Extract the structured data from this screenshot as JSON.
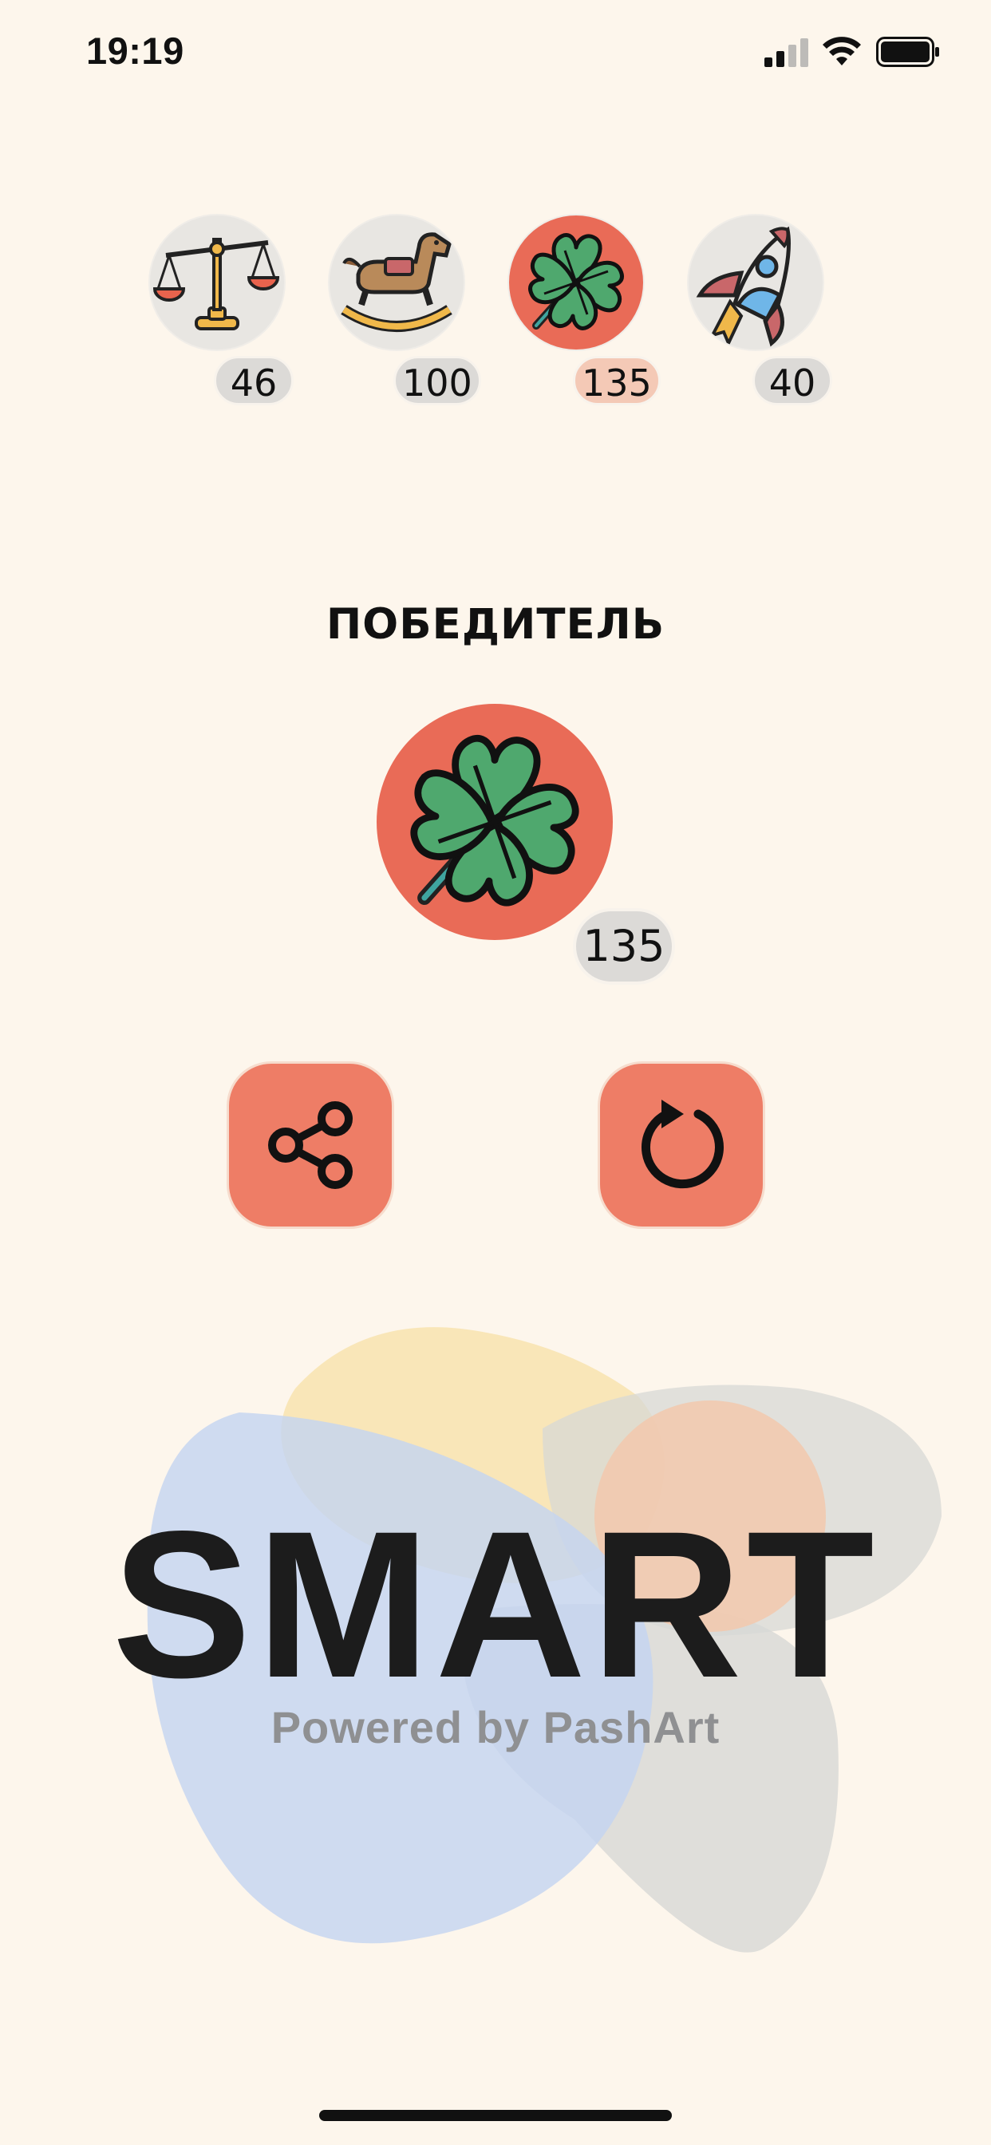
{
  "status_bar": {
    "time": "19:19"
  },
  "players": [
    {
      "icon": "scales-icon",
      "score": "46",
      "active": false
    },
    {
      "icon": "rocking-horse-icon",
      "score": "100",
      "active": false
    },
    {
      "icon": "four-leaf-clover-icon",
      "score": "135",
      "active": true
    },
    {
      "icon": "rocket-icon",
      "score": "40",
      "active": false
    }
  ],
  "winner": {
    "title": "ПОБЕДИТЕЛЬ",
    "icon": "four-leaf-clover-icon",
    "score": "135"
  },
  "actions": {
    "share_icon": "share-icon",
    "restart_icon": "restart-icon"
  },
  "brand": {
    "title": "SMART",
    "subtitle": "Powered by PashArt"
  },
  "colors": {
    "background": "#fdf6ec",
    "accent": "#ee7d66",
    "active_avatar": "#e96b57",
    "pill": "#dcdad7",
    "active_pill": "#f4c9b6"
  }
}
